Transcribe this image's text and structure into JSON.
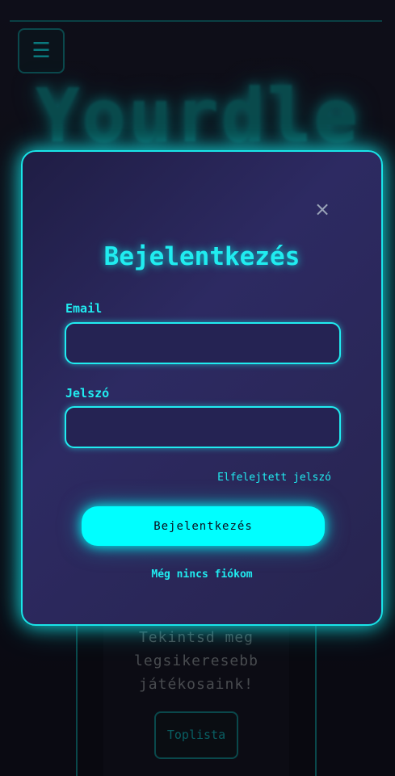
{
  "background": {
    "menu_icon": "☰",
    "logo": "Yourdle",
    "card_text": "Tekintsd meg legsikeresebb játékosaink!",
    "toplist_label": "Toplista"
  },
  "modal": {
    "close_icon": "×",
    "title": "Bejelentkezés",
    "email_label": "Email",
    "email_value": "",
    "password_label": "Jelszó",
    "password_value": "",
    "forgot_label": "Elfelejtett jelszó",
    "submit_label": "Bejelentkezés",
    "register_label": "Még nincs fiókom"
  },
  "colors": {
    "accent": "#20ecf0",
    "button": "#00ffff",
    "modal_bg": "#2d2a62"
  }
}
